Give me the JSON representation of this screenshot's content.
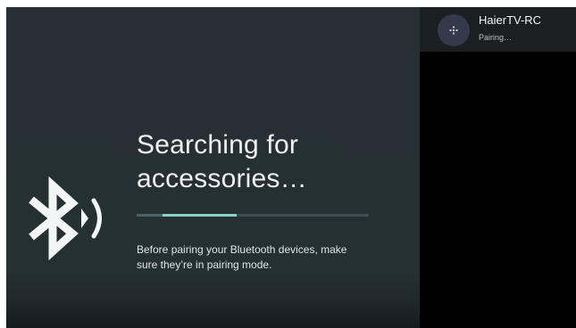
{
  "main": {
    "title_line1": "Searching for",
    "title_line2": "accessories…",
    "description": "Before pairing your Bluetooth devices, make sure they’re in pairing mode.",
    "progress": {
      "segment_start": 0.11,
      "segment_end": 0.43
    },
    "icon": "bluetooth-searching-icon"
  },
  "device_list": {
    "items": [
      {
        "name": "HaierTV-RC",
        "status": "Pairing…",
        "icon": "gamepad-icon"
      }
    ]
  },
  "colors": {
    "background": "#263034",
    "accent": "#8ecfc6",
    "side_background": "#000000",
    "device_row": "#1b1f21"
  }
}
